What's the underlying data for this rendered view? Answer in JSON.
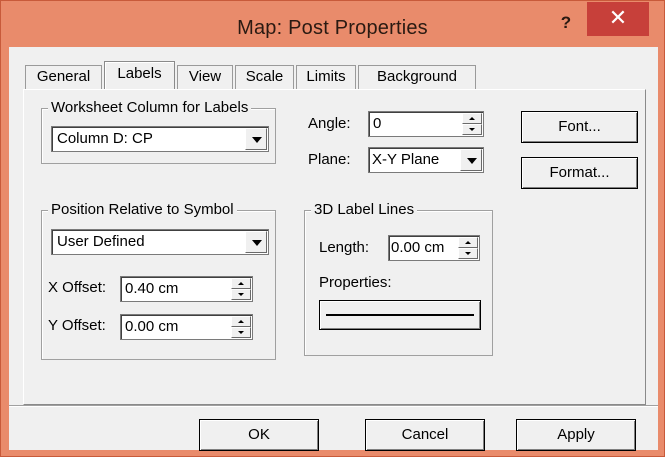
{
  "window": {
    "title": "Map: Post Properties",
    "help_label": "?",
    "close_label": "✕"
  },
  "tabs": [
    {
      "label": "General",
      "active": false
    },
    {
      "label": "Labels",
      "active": true
    },
    {
      "label": "View",
      "active": false
    },
    {
      "label": "Scale",
      "active": false
    },
    {
      "label": "Limits",
      "active": false
    },
    {
      "label": "Background",
      "active": false
    }
  ],
  "labels_tab": {
    "worksheet_group": {
      "title": "Worksheet Column for Labels",
      "column_value": "Column D:  CP"
    },
    "angle": {
      "label": "Angle:",
      "value": "0"
    },
    "plane": {
      "label": "Plane:",
      "value": "X-Y Plane"
    },
    "font_button": "Font...",
    "format_button": "Format...",
    "position_group": {
      "title": "Position Relative to Symbol",
      "position_value": "User Defined",
      "x_offset_label": "X Offset:",
      "x_offset_value": "0.40 cm",
      "y_offset_label": "Y Offset:",
      "y_offset_value": "0.00 cm"
    },
    "label_lines_group": {
      "title": "3D Label Lines",
      "length_label": "Length:",
      "length_value": "0.00 cm",
      "properties_label": "Properties:"
    }
  },
  "footer": {
    "ok_label": "OK",
    "cancel_label": "Cancel",
    "apply_label": "Apply"
  }
}
